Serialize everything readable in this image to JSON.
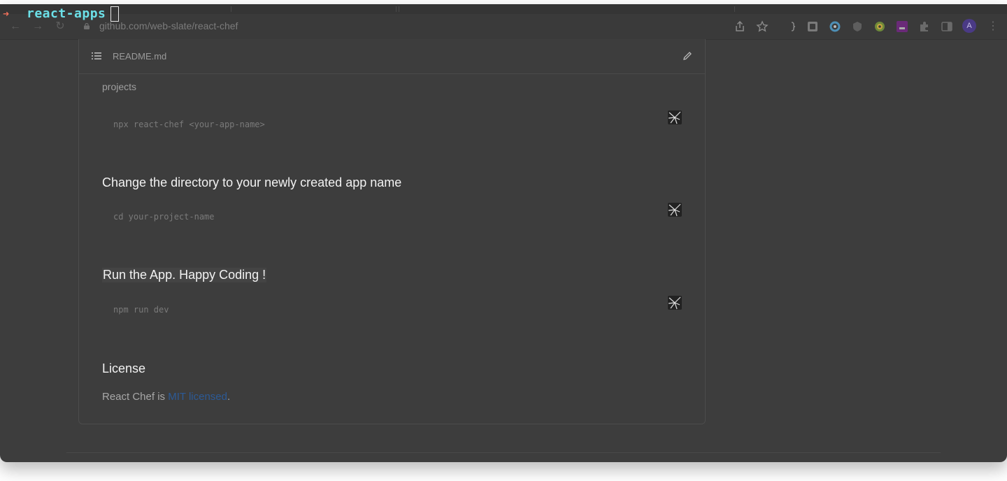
{
  "terminal": {
    "prompt_symbol": "➜",
    "directory": "react-apps"
  },
  "browser": {
    "url": "github.com/web-slate/react-chef",
    "avatar_letter": "A",
    "nav": {
      "back": "←",
      "forward": "→",
      "reload": "↻"
    },
    "menu": "⋮"
  },
  "readme": {
    "filename": "README.md",
    "truncated_line": "projects",
    "code_blocks": [
      {
        "command": "npx react-chef <your-app-name>"
      },
      {
        "command": "cd your-project-name"
      },
      {
        "command": "npm run dev"
      }
    ],
    "headings": {
      "change_dir": "Change the directory to your newly created app name",
      "run_app": "Run the App. Happy Coding !"
    },
    "license": {
      "title": "License",
      "prefix": "React Chef is ",
      "link_text": "MIT licensed",
      "suffix": "."
    }
  },
  "colors": {
    "link": "#2c5a96",
    "terminal_dir": "#6ce0e8",
    "prompt_arrow": "#f0705a"
  },
  "icons": [
    "toc-icon",
    "pencil-icon",
    "copy-icon",
    "share-icon",
    "star-icon",
    "extension-icon",
    "sidebar-icon",
    "lock-icon"
  ]
}
